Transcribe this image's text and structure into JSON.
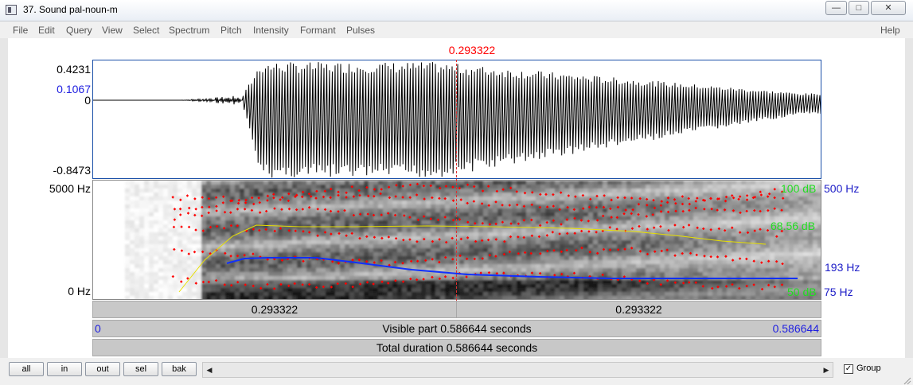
{
  "window": {
    "title": "37. Sound pal-noun-m",
    "minimize_symbol": "—",
    "maximize_symbol": "□",
    "close_symbol": "✕"
  },
  "menu": {
    "items": [
      "File",
      "Edit",
      "Query",
      "View",
      "Select",
      "Spectrum",
      "Pitch",
      "Intensity",
      "Formant",
      "Pulses"
    ],
    "help": "Help"
  },
  "cursor": {
    "time": "0.293322"
  },
  "waveform": {
    "y_max": "0.4231",
    "y_cursor": "0.1067",
    "y_zero": "0",
    "y_min": "-0.8473"
  },
  "spectrogram": {
    "freq_top": "5000 Hz",
    "freq_bottom": "0 Hz",
    "intensity_top": "100 dB",
    "intensity_mid": "68.56 dB",
    "intensity_bottom": "50 dB",
    "pitch_top": "500 Hz",
    "pitch_mid": "193 Hz",
    "pitch_bottom": "75 Hz"
  },
  "time_bars": {
    "left_segment": "0.293322",
    "right_segment": "0.293322",
    "visible_start": "0",
    "visible_text": "Visible part 0.586644 seconds",
    "visible_end": "0.586644",
    "total_text": "Total duration 0.586644 seconds"
  },
  "bottom": {
    "buttons": [
      "all",
      "in",
      "out",
      "sel",
      "bak"
    ],
    "group_label": "Group",
    "group_checked": true,
    "scroll_left": "◀",
    "scroll_right": "▶"
  },
  "colors": {
    "cursor": "#ff0000",
    "pitch_track": "#1030ff",
    "intensity_track": "#e8e000",
    "formant_dots": "#ff0000",
    "axis_blue": "#2020e0",
    "axis_green": "#22dd22"
  }
}
